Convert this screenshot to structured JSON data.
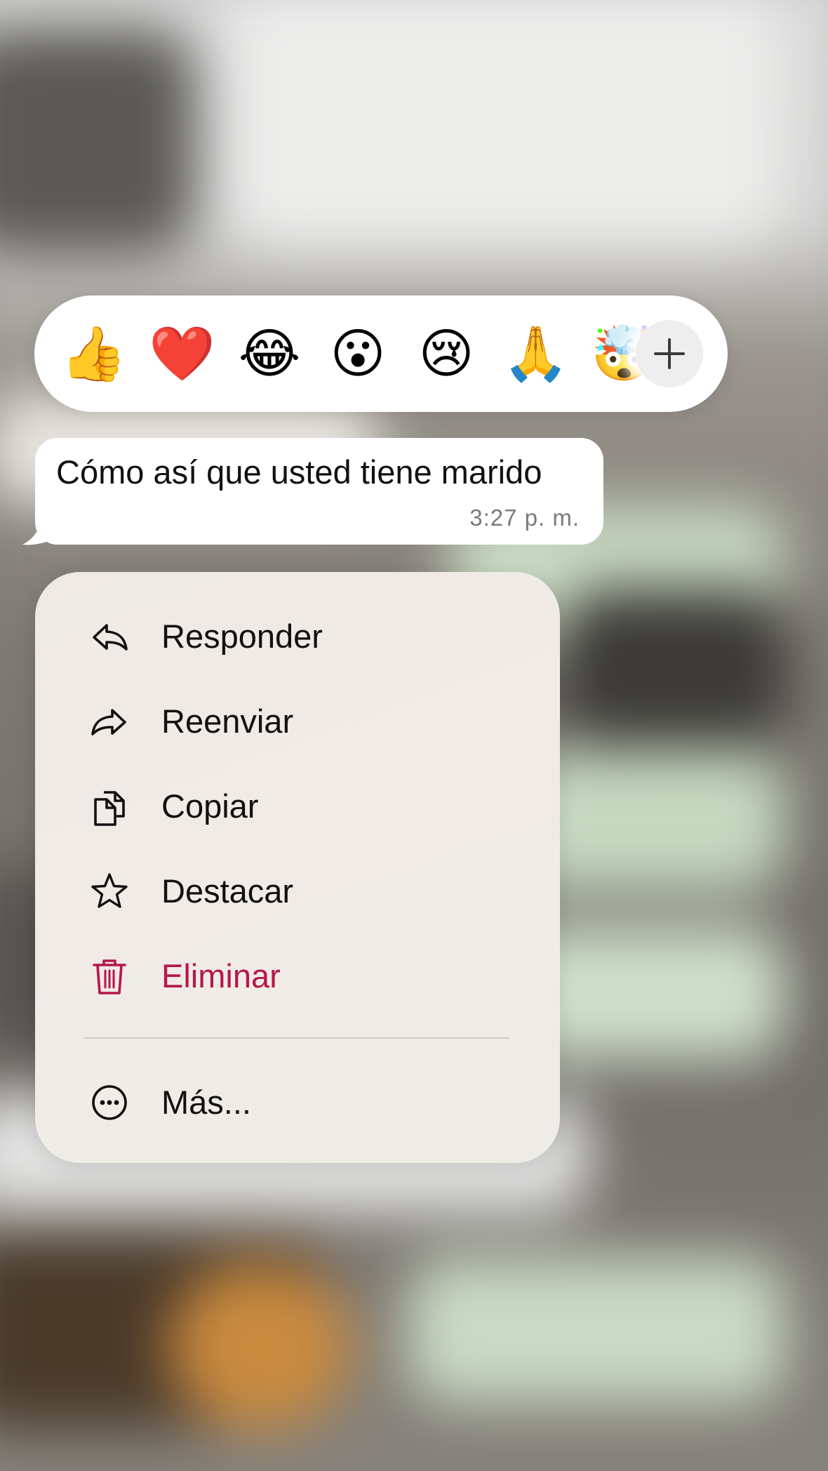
{
  "reactions": {
    "emojis": [
      {
        "glyph": "👍",
        "name": "thumbs-up"
      },
      {
        "glyph": "❤️",
        "name": "red-heart"
      },
      {
        "glyph": "😂",
        "name": "tears-of-joy"
      },
      {
        "glyph": "😮",
        "name": "open-mouth"
      },
      {
        "glyph": "😢",
        "name": "crying-face"
      },
      {
        "glyph": "🙏",
        "name": "folded-hands"
      },
      {
        "glyph": "🤯",
        "name": "exploding-head"
      }
    ],
    "add_icon": "plus-icon"
  },
  "message": {
    "text": "Cómo así que usted tiene marido",
    "time": "3:27 p. m."
  },
  "menu": {
    "items": [
      {
        "label": "Responder",
        "icon": "reply-icon"
      },
      {
        "label": "Reenviar",
        "icon": "forward-icon"
      },
      {
        "label": "Copiar",
        "icon": "copy-icon"
      },
      {
        "label": "Destacar",
        "icon": "star-icon"
      },
      {
        "label": "Eliminar",
        "icon": "trash-icon"
      },
      {
        "label": "Más...",
        "icon": "more-icon"
      }
    ]
  },
  "colors": {
    "danger": "#b5174a",
    "text": "#111111",
    "time": "#7a7a7a"
  }
}
